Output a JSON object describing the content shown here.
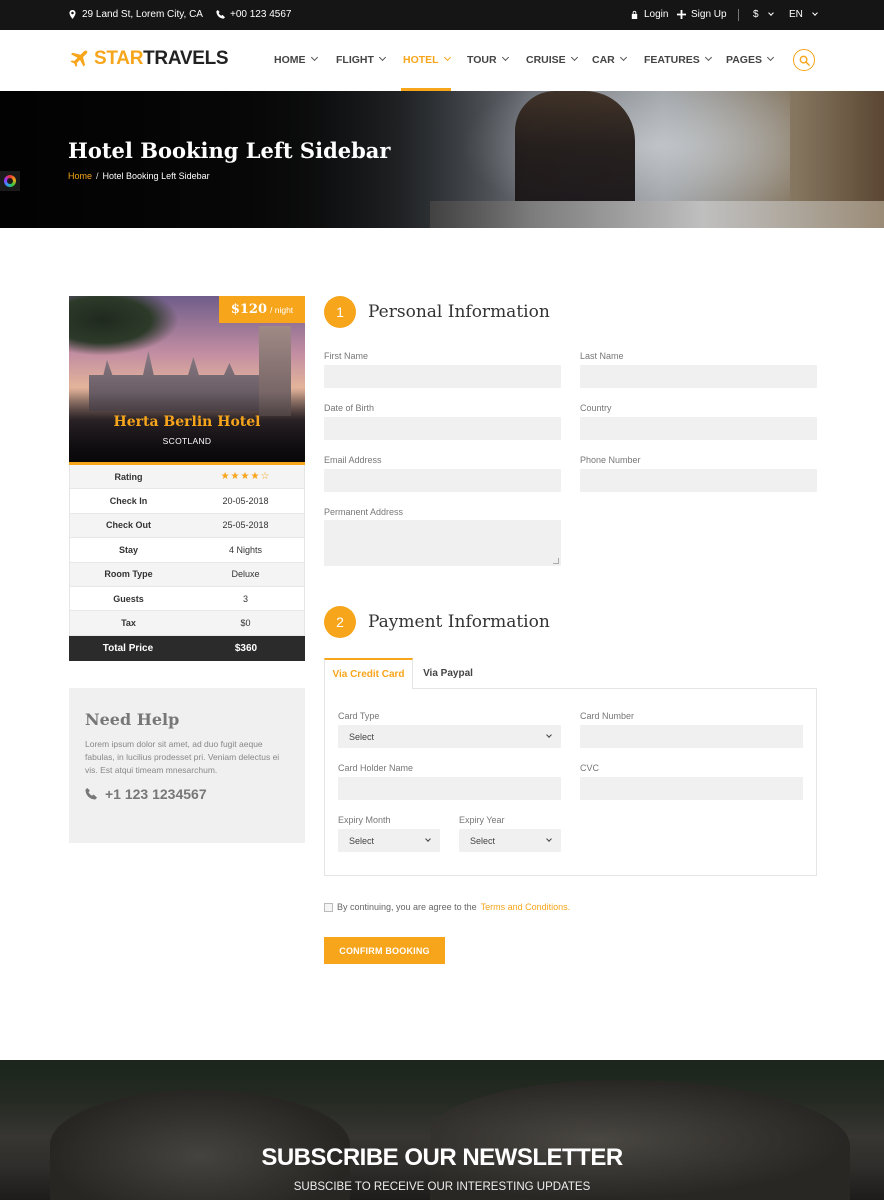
{
  "topbar": {
    "address": "29 Land St, Lorem City, CA",
    "phone": "+00 123 4567",
    "login": "Login",
    "signup": "Sign Up",
    "currency": "$",
    "language": "EN"
  },
  "logo": {
    "part1": "STAR",
    "part2": "TRAVELS"
  },
  "nav": [
    {
      "label": "HOME"
    },
    {
      "label": "FLIGHT"
    },
    {
      "label": "HOTEL"
    },
    {
      "label": "TOUR"
    },
    {
      "label": "CRUISE"
    },
    {
      "label": "CAR"
    },
    {
      "label": "FEATURES"
    },
    {
      "label": "PAGES"
    }
  ],
  "hero": {
    "title": "Hotel Booking Left Sidebar",
    "breadcrumb_home": "Home",
    "breadcrumb_sep": "/",
    "breadcrumb_current": "Hotel Booking Left Sidebar"
  },
  "hotel": {
    "price": "$120",
    "per": "/ night",
    "name": "Herta Berlin Hotel",
    "location": "SCOTLAND",
    "rating_label": "Rating",
    "rating_stars": "★★★★☆",
    "rating_value": 4,
    "rows": [
      {
        "label": "Check In",
        "value": "20-05-2018"
      },
      {
        "label": "Check Out",
        "value": "25-05-2018"
      },
      {
        "label": "Stay",
        "value": "4 Nights"
      },
      {
        "label": "Room Type",
        "value": "Deluxe"
      },
      {
        "label": "Guests",
        "value": "3"
      },
      {
        "label": "Tax",
        "value": "$0"
      }
    ],
    "total_label": "Total Price",
    "total_value": "$360"
  },
  "help": {
    "title": "Need Help",
    "text": "Lorem ipsum dolor sit amet, ad duo fugit aeque fabulas, in lucilius prodesset pri. Veniam delectus ei vis. Est atqui timeam mnesarchum.",
    "phone": "+1 123 1234567"
  },
  "personal": {
    "step": "1",
    "title": "Personal Information",
    "first_name": "First Name",
    "last_name": "Last Name",
    "dob": "Date of Birth",
    "country": "Country",
    "email": "Email Address",
    "phone": "Phone Number",
    "address": "Permanent Address"
  },
  "payment": {
    "step": "2",
    "title": "Payment Information",
    "tab_card": "Via Credit Card",
    "tab_paypal": "Via Paypal",
    "card_type": "Card Type",
    "card_type_value": "Select",
    "card_number": "Card Number",
    "holder": "Card Holder Name",
    "cvc": "CVC",
    "exp_month": "Expiry Month",
    "exp_month_value": "Select",
    "exp_year": "Expiry Year",
    "exp_year_value": "Select"
  },
  "agree": {
    "text": "By continuing, you are agree to the",
    "link": "Terms and Conditions."
  },
  "confirm": "CONFIRM BOOKING",
  "newsletter": {
    "title": "SUBSCRIBE OUR NEWSLETTER",
    "subtitle": "SUBSCIBE TO RECEIVE OUR INTERESTING UPDATES"
  },
  "colors": {
    "accent": "#f7a51b",
    "dark": "#151515"
  }
}
